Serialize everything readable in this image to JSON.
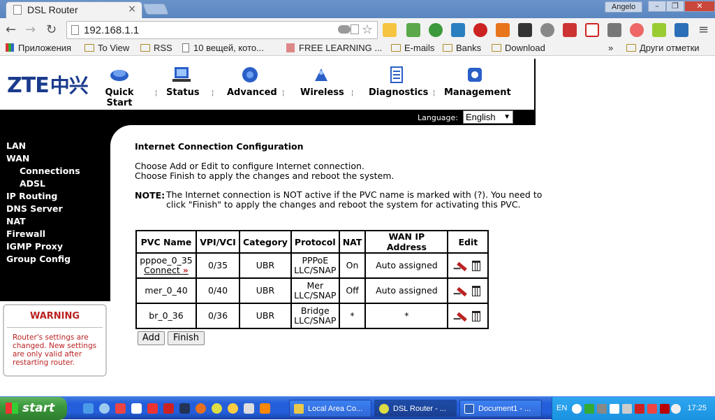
{
  "browser": {
    "tab_title": "DSL Router",
    "user": "Angelo",
    "url": "192.168.1.1",
    "bookmarks": [
      "Приложения",
      "To View",
      "RSS",
      "10 вещей, кото...",
      "FREE LEARNING ...",
      "E-mails",
      "Banks",
      "Download"
    ],
    "more_bookmarks": "»",
    "other_bookmarks": "Други отметки"
  },
  "router": {
    "logo": "ZTE",
    "logo_cn": "中兴",
    "nav": [
      "Quick Start",
      "Status",
      "Advanced",
      "Wireless",
      "Diagnostics",
      "Management"
    ],
    "language_label": "Language:",
    "language_value": "English",
    "sidebar": [
      {
        "label": "LAN",
        "sub": false
      },
      {
        "label": "WAN",
        "sub": false
      },
      {
        "label": "Connections",
        "sub": true
      },
      {
        "label": "ADSL",
        "sub": true
      },
      {
        "label": "IP Routing",
        "sub": false
      },
      {
        "label": "DNS Server",
        "sub": false
      },
      {
        "label": "NAT",
        "sub": false
      },
      {
        "label": "Firewall",
        "sub": false
      },
      {
        "label": "IGMP Proxy",
        "sub": false
      },
      {
        "label": "Group Config",
        "sub": false
      }
    ],
    "warning": {
      "title": "WARNING",
      "text": "Router's settings are changed. New settings are only valid after restarting router."
    },
    "content": {
      "title": "Internet Connection Configuration",
      "line1": "Choose Add or Edit to configure Internet connection.",
      "line2": "Choose Finish to apply the changes and reboot the system.",
      "note_label": "NOTE:",
      "note_text": "The Internet connection is NOT active if the PVC name is marked with (?). You need to click \"Finish\" to apply the changes and reboot the system for activating this PVC."
    },
    "table": {
      "headers": [
        "PVC Name",
        "VPI/VCI",
        "Category",
        "Protocol",
        "NAT",
        "WAN IP Address",
        "Edit"
      ],
      "rows": [
        {
          "pvc": "pppoe_0_35",
          "connect": "Connect",
          "vpivci": "0/35",
          "category": "UBR",
          "protocol1": "PPPoE",
          "protocol2": "LLC/SNAP",
          "nat": "On",
          "wanip": "Auto assigned"
        },
        {
          "pvc": "mer_0_40",
          "connect": "",
          "vpivci": "0/40",
          "category": "UBR",
          "protocol1": "Mer",
          "protocol2": "LLC/SNAP",
          "nat": "Off",
          "wanip": "Auto assigned"
        },
        {
          "pvc": "br_0_36",
          "connect": "",
          "vpivci": "0/36",
          "category": "UBR",
          "protocol1": "Bridge",
          "protocol2": "LLC/SNAP",
          "nat": "*",
          "wanip": "*"
        }
      ]
    },
    "buttons": {
      "add": "Add",
      "finish": "Finish"
    }
  },
  "taskbar": {
    "start": "start",
    "tasks": [
      "Local Area Co...",
      "DSL Router - ...",
      "Document1 - ..."
    ],
    "lang": "EN",
    "clock": "17:25"
  }
}
